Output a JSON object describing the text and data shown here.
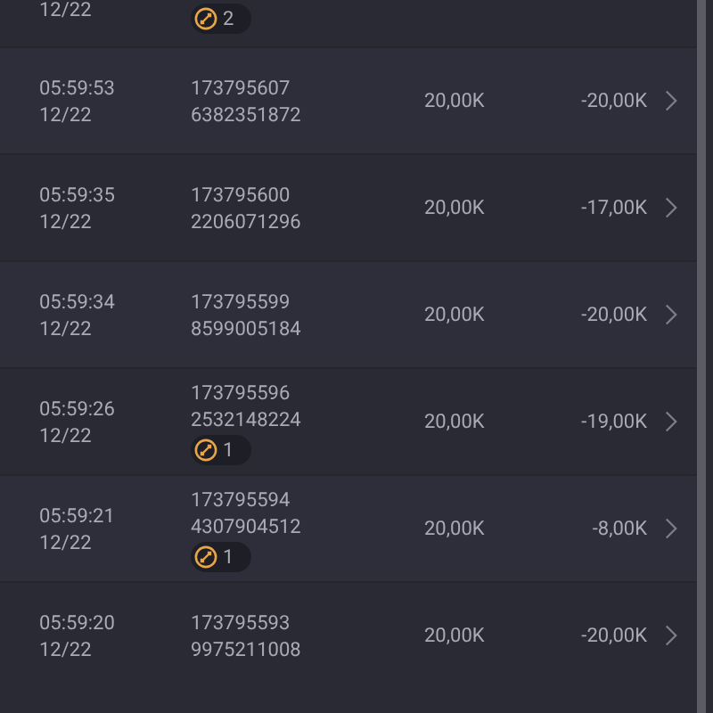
{
  "top_row": {
    "date": "12/22",
    "badge": "2"
  },
  "rows": [
    {
      "time": "05:59:53",
      "date": "12/22",
      "id_1": "173795607",
      "id_2": "6382351872",
      "amount": "20,00K",
      "result": "-20,00K"
    },
    {
      "time": "05:59:35",
      "date": "12/22",
      "id_1": "173795600",
      "id_2": "2206071296",
      "amount": "20,00K",
      "result": "-17,00K"
    },
    {
      "time": "05:59:34",
      "date": "12/22",
      "id_1": "173795599",
      "id_2": "8599005184",
      "amount": "20,00K",
      "result": "-20,00K"
    },
    {
      "time": "05:59:26",
      "date": "12/22",
      "id_1": "173795596",
      "id_2": "2532148224",
      "badge": "1",
      "amount": "20,00K",
      "result": "-19,00K"
    },
    {
      "time": "05:59:21",
      "date": "12/22",
      "id_1": "173795594",
      "id_2": "4307904512",
      "badge": "1",
      "amount": "20,00K",
      "result": "-8,00K"
    },
    {
      "time": "05:59:20",
      "date": "12/22",
      "id_1": "173795593",
      "id_2": "9975211008",
      "amount": "20,00K",
      "result": "-20,00K"
    }
  ]
}
